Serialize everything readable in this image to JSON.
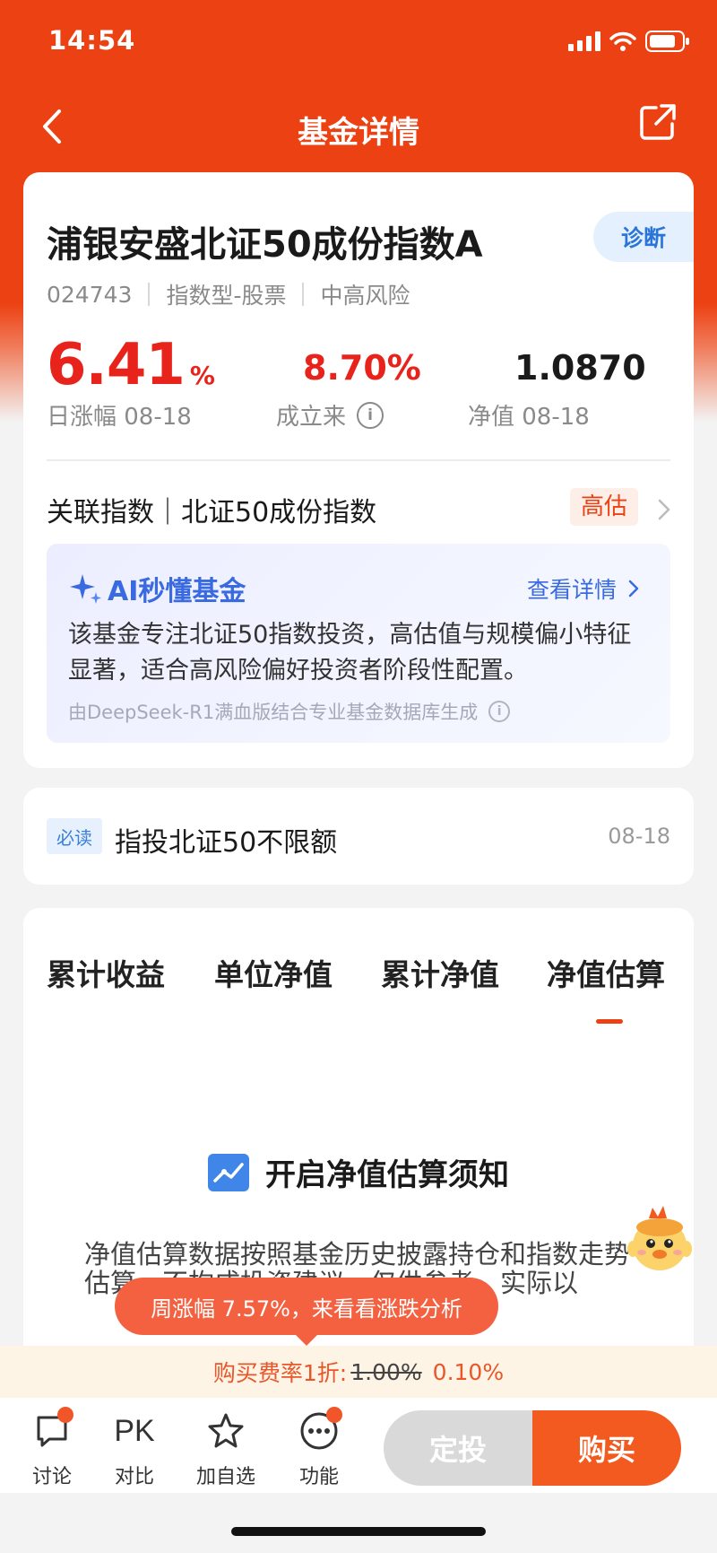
{
  "status_bar": {
    "time": "14:54"
  },
  "nav": {
    "title": "基金详情"
  },
  "fund": {
    "name": "浦银安盛北证50成份指数A",
    "diagnose_label": "诊断",
    "code": "024743",
    "type": "指数型-股票",
    "risk": "中高风险",
    "daily_change_value": "6.41",
    "daily_change_unit": "%",
    "daily_change_label": "日涨幅 08-18",
    "since_inception_value": "8.70%",
    "since_inception_label": "成立来",
    "nav_value": "1.0870",
    "nav_label": "净值 08-18"
  },
  "related_index": {
    "text": "关联指数｜北证50成份指数",
    "tag": "高估"
  },
  "ai": {
    "title": "AI秒懂基金",
    "more": "查看详情",
    "desc": "该基金专注北证50指数投资，高估值与规模偏小特征显著，适合高风险偏好投资者阶段性配置。",
    "source": "由DeepSeek-R1满血版结合专业基金数据库生成"
  },
  "notice": {
    "badge": "必读",
    "text": "指投北证50不限额",
    "date": "08-18"
  },
  "tabs": [
    {
      "label": "累计收益"
    },
    {
      "label": "单位净值"
    },
    {
      "label": "累计净值"
    },
    {
      "label": "净值估算",
      "active": true
    }
  ],
  "estimate": {
    "title": "开启净值估算须知",
    "desc": "净值估算数据按照基金历史披露持仓和指数走势估算，不构成投资建议，仅供参考，实际以"
  },
  "tooltip": {
    "text": "周涨幅 7.57%，来看看涨跌分析"
  },
  "fee": {
    "label": "购买费率1折:",
    "original": "1.00%",
    "discount": "0.10%"
  },
  "bottom_bar": {
    "discuss": "讨论",
    "compare_icon_text": "PK",
    "compare": "对比",
    "watchlist": "加自选",
    "functions": "功能",
    "sip": "定投",
    "buy": "购买"
  },
  "colors": {
    "brand": "#ec4113",
    "up_red": "#e8231b",
    "ai_blue": "#3a6ae0"
  }
}
